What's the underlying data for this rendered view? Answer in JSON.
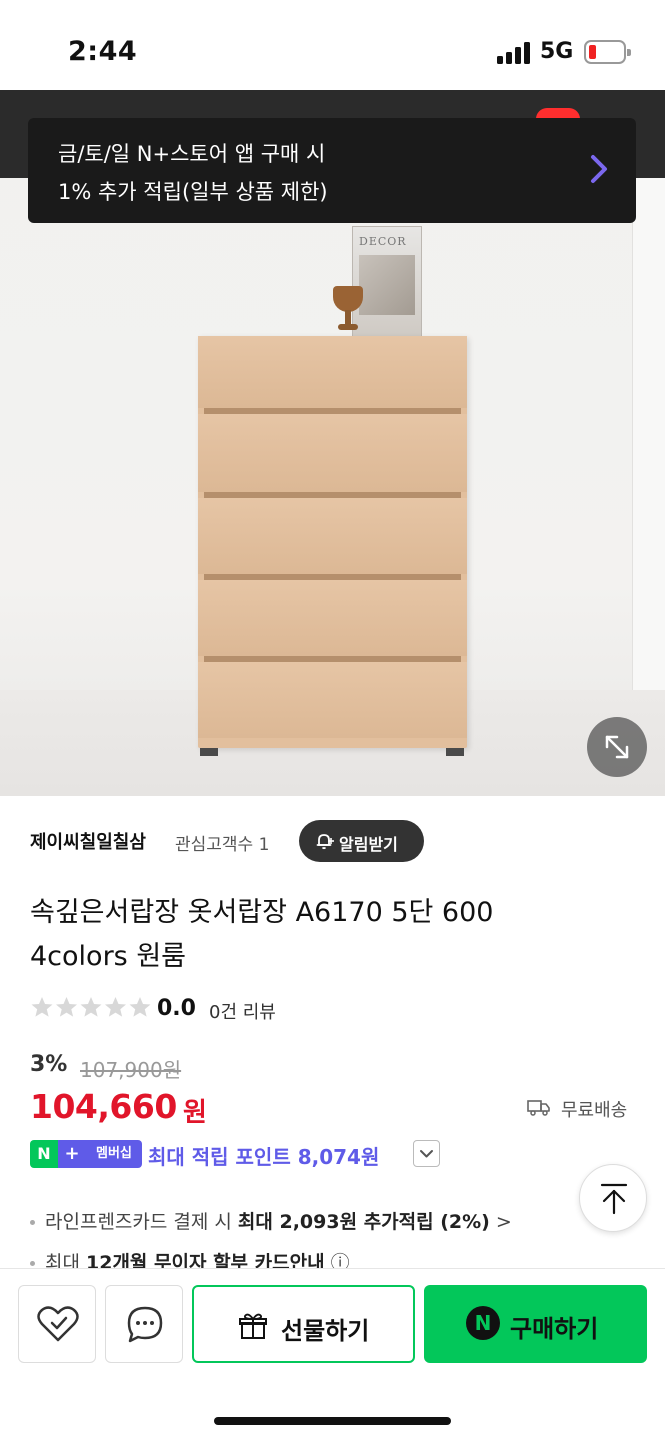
{
  "status_bar": {
    "time": "2:44",
    "network": "5G",
    "battery_level": 0.1
  },
  "promo": {
    "line1": "금/토/일 N+스토어 앱 구매 시",
    "line2": "1% 추가 적립(일부 상품 제한)",
    "arrow_color": "#7b68ee"
  },
  "product_image": {
    "magazine_text": "DECOR"
  },
  "store": {
    "name": "제이씨칠일칠삼",
    "followers": "관심고객수 1",
    "notify_label": "알림받기"
  },
  "product": {
    "title_line1": "속깊은서랍장 옷서랍장 A6170 5단 600",
    "title_line2": "4colors 원룸",
    "star_rating": 0,
    "rating": "0.0",
    "reviews": "0건 리뷰",
    "discount": "3%",
    "original_price": "107,900원",
    "price": "104,660",
    "price_unit": "원",
    "shipping": "무료배송"
  },
  "membership": {
    "n_label": "N",
    "plus_label": "+",
    "badge_label": "멤버십",
    "points_text": "최대 적립 포인트 8,074원",
    "color": "#5f5be8"
  },
  "benefits": [
    {
      "prefix": "라인프렌즈카드 결제 시 ",
      "bold": "최대 2,093원 추가적립 (2%)",
      "suffix": " >"
    },
    {
      "prefix": "최대 ",
      "bold": "12개월 무이자 할부 카드안내",
      "suffix": " ⓘ"
    }
  ],
  "actions": {
    "gift_label": "선물하기",
    "buy_n": "N",
    "buy_label": "구매하기",
    "accent": "#03c75a"
  }
}
